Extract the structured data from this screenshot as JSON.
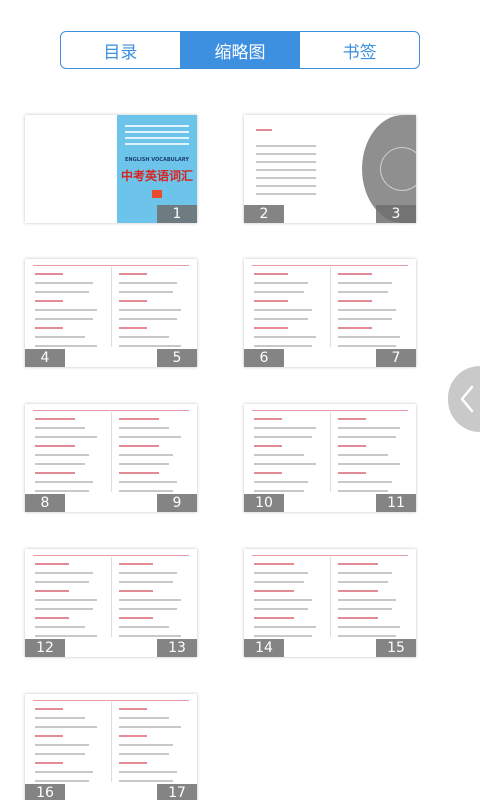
{
  "tabs": [
    {
      "label": "目录",
      "active": false
    },
    {
      "label": "缩略图",
      "active": true
    },
    {
      "label": "书签",
      "active": false
    }
  ],
  "cover": {
    "title": "中考英语词汇",
    "subtitle_en": "ENGLISH VOCABULARY"
  },
  "thumbnails": [
    {
      "page": "1"
    },
    {
      "page": "2"
    },
    {
      "page": "3"
    },
    {
      "page": "4"
    },
    {
      "page": "5"
    },
    {
      "page": "6"
    },
    {
      "page": "7"
    },
    {
      "page": "8"
    },
    {
      "page": "9"
    },
    {
      "page": "10"
    },
    {
      "page": "11"
    },
    {
      "page": "12"
    },
    {
      "page": "13"
    },
    {
      "page": "14"
    },
    {
      "page": "15"
    },
    {
      "page": "16"
    },
    {
      "page": "17"
    }
  ],
  "colors": {
    "accent": "#3d8fe0",
    "cover_blue": "#6cc4ea",
    "cover_red": "#d8241f",
    "page_badge": "#6e6e6e"
  },
  "icons": {
    "side_handle": "chevron-left-icon"
  }
}
